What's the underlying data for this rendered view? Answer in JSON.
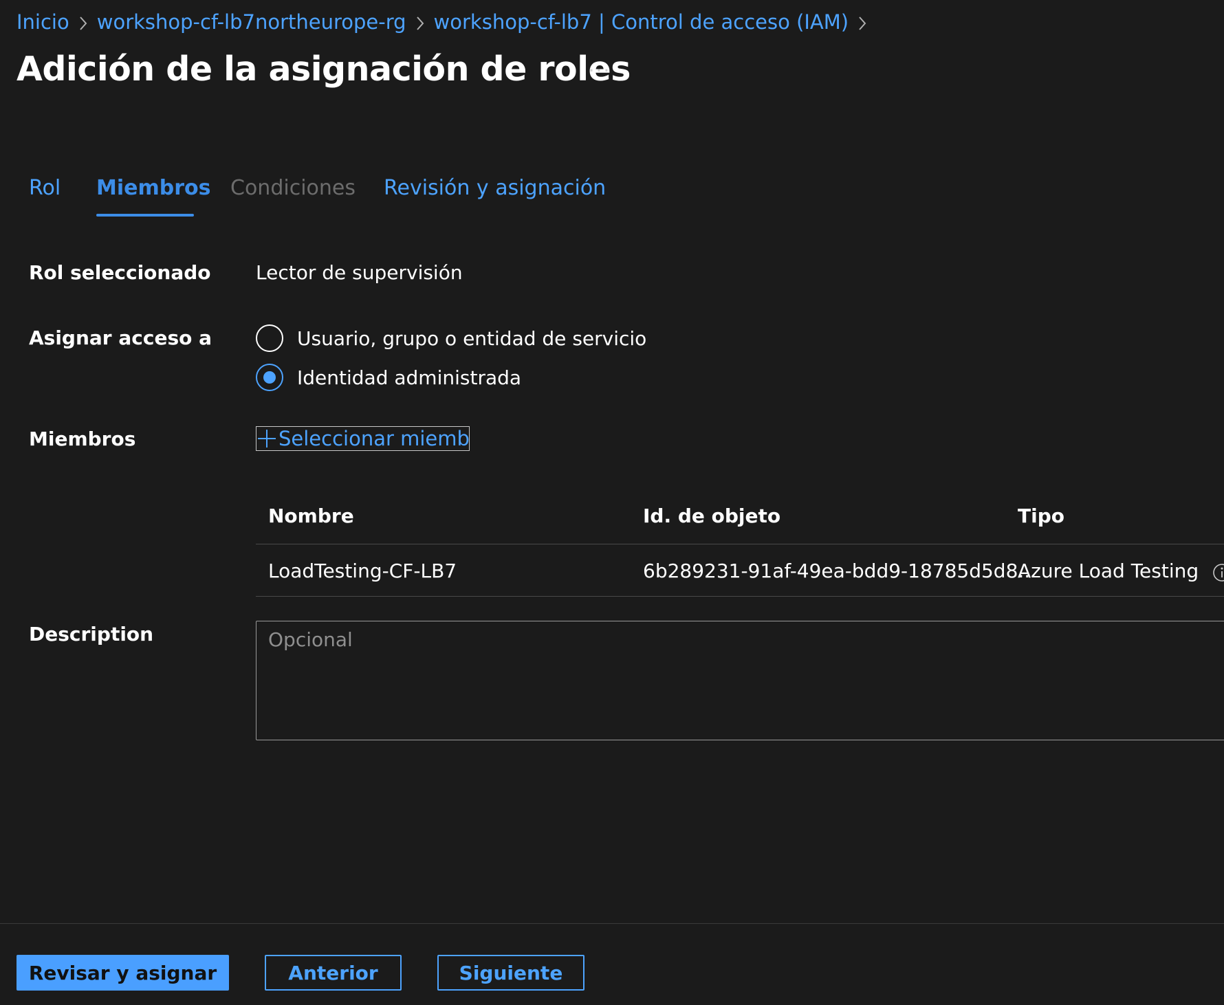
{
  "breadcrumb": [
    {
      "label": "Inicio"
    },
    {
      "label": "workshop-cf-lb7northeurope-rg"
    },
    {
      "label": "workshop-cf-lb7 | Control de acceso (IAM)"
    }
  ],
  "page": {
    "title": "Adición de la asignación de roles",
    "more_label": "···"
  },
  "tabs": [
    {
      "label": "Rol",
      "state": "link"
    },
    {
      "label": "Miembros",
      "state": "active"
    },
    {
      "label": "Condiciones",
      "state": "disabled"
    },
    {
      "label": "Revisión y asignación",
      "state": "link"
    }
  ],
  "form": {
    "selected_role_label": "Rol seleccionado",
    "selected_role_value": "Lector de supervisión",
    "assign_access_label": "Asignar acceso a",
    "assign_access_options": [
      {
        "label": "Usuario, grupo o entidad de servicio",
        "checked": false
      },
      {
        "label": "Identidad administrada",
        "checked": true
      }
    ],
    "members_label": "Miembros",
    "select_members_label": "Seleccionar miembros",
    "description_label": "Description",
    "description_placeholder": "Opcional",
    "description_value": ""
  },
  "members_table": {
    "columns": [
      "Nombre",
      "Id. de objeto",
      "Tipo"
    ],
    "rows": [
      {
        "name": "LoadTesting-CF-LB7",
        "object_id": "6b289231-91af-49ea-bdd9-18785d5d8...",
        "type": "Azure Load Testing"
      }
    ]
  },
  "footer": {
    "review_assign_label": "Revisar y asignar",
    "previous_label": "Anterior",
    "next_label": "Siguiente"
  },
  "colors": {
    "background": "#1b1b1b",
    "link": "#4da3ff",
    "primary_button": "#4a9fff",
    "disabled_text": "#6c6c6c"
  }
}
